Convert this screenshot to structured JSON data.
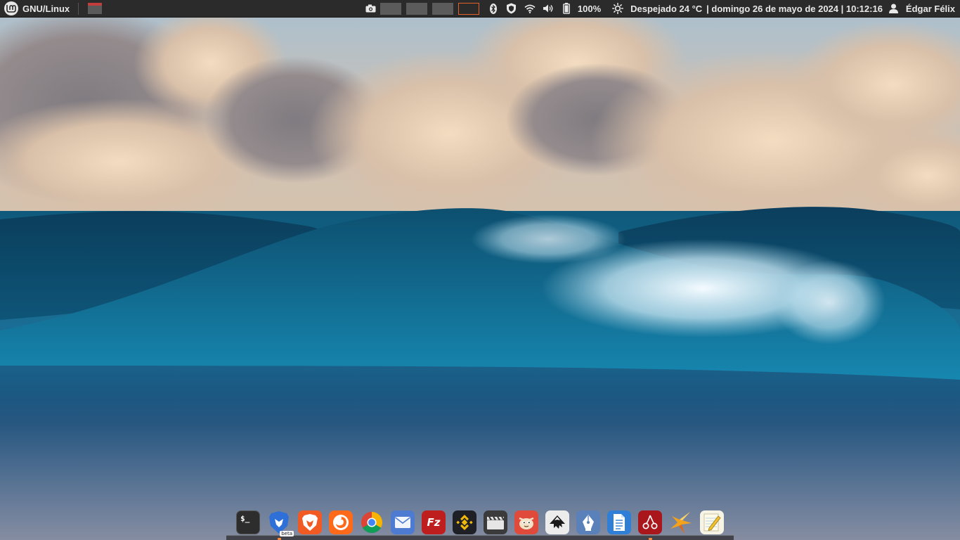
{
  "top_panel": {
    "menu_label": "GNU/Linux",
    "workspaces": [
      "workspace-1",
      "workspace-2",
      "workspace-3",
      "workspace-4"
    ],
    "active_workspace_index": 3,
    "battery_percent": "100%",
    "weather": "Despejado 24 °C",
    "datetime": "| domingo 26 de mayo de 2024 | 10:12:16",
    "user_name": "Édgar Félix"
  },
  "tray_icons": [
    "screenshot-icon",
    "bluetooth-icon",
    "shield-icon",
    "wifi-icon",
    "volume-icon",
    "battery-icon",
    "sun-icon",
    "user-icon"
  ],
  "dock": {
    "apps": [
      {
        "name": "terminal",
        "icon": "terminal-icon",
        "glyph": "$_",
        "running": false
      },
      {
        "name": "brave-beta",
        "icon": "brave-beta-icon",
        "badge": "beta",
        "running": true
      },
      {
        "name": "brave",
        "icon": "brave-icon",
        "running": false
      },
      {
        "name": "firefox",
        "icon": "firefox-icon",
        "running": false
      },
      {
        "name": "chrome",
        "icon": "chrome-icon",
        "running": false
      },
      {
        "name": "mail",
        "icon": "mail-icon",
        "running": false
      },
      {
        "name": "filezilla",
        "icon": "filezilla-icon",
        "glyph": "Fz",
        "running": false
      },
      {
        "name": "binance",
        "icon": "binance-icon",
        "running": false
      },
      {
        "name": "video-editor",
        "icon": "clapperboard-icon",
        "running": false
      },
      {
        "name": "gimp",
        "icon": "gimp-icon",
        "running": false
      },
      {
        "name": "inkscape",
        "icon": "inkscape-icon",
        "running": false
      },
      {
        "name": "vector-pen",
        "icon": "pen-nib-icon",
        "running": false
      },
      {
        "name": "documents",
        "icon": "document-icon",
        "running": false
      },
      {
        "name": "cherrytree",
        "icon": "cherry-icon",
        "running": true
      },
      {
        "name": "star-app",
        "icon": "star-icon",
        "running": false
      },
      {
        "name": "notes",
        "icon": "notepad-icon",
        "running": false
      }
    ]
  },
  "colors": {
    "panel_bg": "#2b2b2b",
    "panel_text": "#e8e8e8",
    "active_workspace_border": "#e0612a",
    "running_indicator": "#ff8a3a"
  }
}
